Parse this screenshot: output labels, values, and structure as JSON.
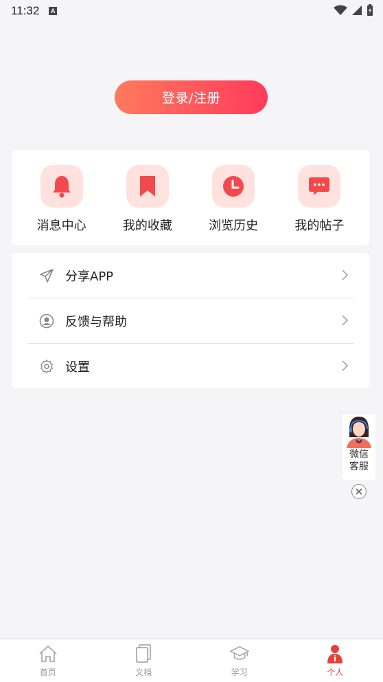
{
  "status_bar": {
    "time": "11:32"
  },
  "login": {
    "label": "登录/注册"
  },
  "quick_actions": [
    {
      "label": "消息中心",
      "icon": "bell-icon"
    },
    {
      "label": "我的收藏",
      "icon": "bookmark-icon"
    },
    {
      "label": "浏览历史",
      "icon": "clock-icon"
    },
    {
      "label": "我的帖子",
      "icon": "chat-bubble-icon"
    }
  ],
  "menu": [
    {
      "label": "分享APP",
      "icon": "send-icon"
    },
    {
      "label": "反馈与帮助",
      "icon": "user-circle-icon"
    },
    {
      "label": "设置",
      "icon": "gear-icon"
    }
  ],
  "service_widget": {
    "label": "微信客服"
  },
  "tabs": [
    {
      "label": "首页",
      "icon": "home-icon",
      "active": false
    },
    {
      "label": "文档",
      "icon": "document-icon",
      "active": false
    },
    {
      "label": "学习",
      "icon": "graduation-cap-icon",
      "active": false
    },
    {
      "label": "个人",
      "icon": "person-icon",
      "active": true
    }
  ],
  "colors": {
    "accent": "#ff3b5c",
    "accent_start": "#ff7a5c",
    "icon_bg": "#ffe2de",
    "icon_fg": "#f2494d",
    "tab_active": "#e8413b"
  }
}
